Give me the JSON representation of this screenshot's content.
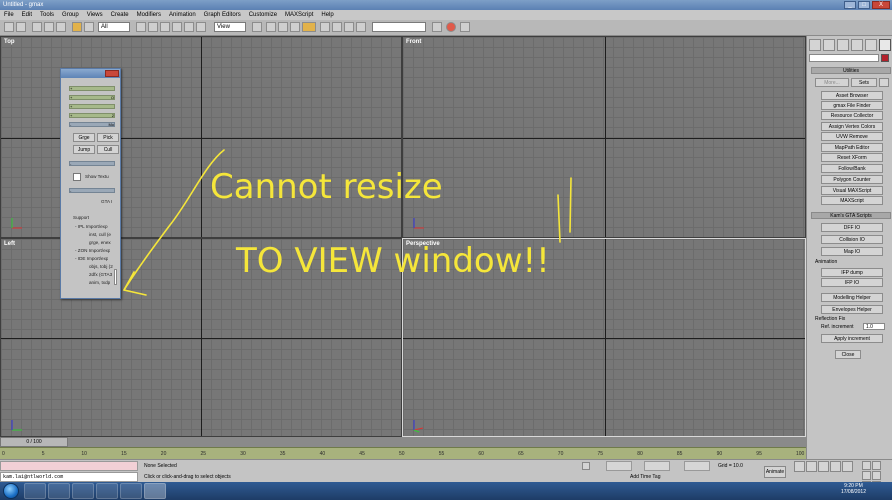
{
  "window": {
    "title": "Untitled - gmax",
    "buttons": [
      "_",
      "□",
      "X"
    ]
  },
  "menu": [
    "File",
    "Edit",
    "Tools",
    "Group",
    "Views",
    "Create",
    "Modifiers",
    "Animation",
    "Graph Editors",
    "Customize",
    "MAXScript",
    "Help"
  ],
  "toolbar": {
    "filter": "All",
    "refcoord": "View",
    "named_selection": ""
  },
  "viewports": {
    "top": "Top",
    "front": "Front",
    "left": "Left",
    "perspective": "Perspective"
  },
  "annotation": {
    "line1": "Cannot resize",
    "line2": "TO VIEW window!!"
  },
  "floater": {
    "rows": [
      "+",
      "+",
      "+",
      "+"
    ],
    "row_suffix": [
      "",
      "O",
      "",
      "2"
    ],
    "section": "Mo",
    "btn_merge": "Grge",
    "btn_pick": "Pick",
    "btn_jump": "Jump",
    "btn_cull": "Cull",
    "checkbox_label": "Show Textu",
    "gta_label": "GTA I",
    "support_title": "Support",
    "support_lines": [
      "- IPL Import/exp",
      "inst, cull (e",
      "grge, enex",
      "- ZON Import/exp",
      "- IDE Import/exp",
      "objs, tobj (2",
      "2dfx (GTA3",
      "anim, txdp"
    ]
  },
  "cmdpanel": {
    "utilities_header": "Utilities",
    "more_label": "More...",
    "sets_label": "Sets",
    "utilities": [
      "Asset Browser",
      "gmax File Finder",
      "Resource Collector",
      "Assign Vertex Colors",
      "UVW Remove",
      "MapPath Editor",
      "Reset XForm",
      "Follow/Bank",
      "Polygon Counter",
      "Visual MAXScript",
      "MAXScript"
    ],
    "kams_header": "Kam's GTA Scripts",
    "kams": [
      "DFF IO",
      "Collision IO",
      "Map IO"
    ],
    "animation_label": "Animation",
    "animation_btns": [
      "IFP dump",
      "IFP IO"
    ],
    "helper_btns": [
      "Modelling Helper",
      "Envelopes Helper"
    ],
    "reflection_label": "Reflection Fix",
    "ref_increment_label": "Ref. increment",
    "ref_increment_value": "1.0",
    "apply_label": "Apply increment",
    "close_label": "Close"
  },
  "timeline": {
    "frame": "0 / 100",
    "ticks": [
      "0",
      "5",
      "10",
      "15",
      "20",
      "25",
      "30",
      "35",
      "40",
      "45",
      "50",
      "55",
      "60",
      "65",
      "70",
      "75",
      "80",
      "85",
      "90",
      "95",
      "100"
    ]
  },
  "status": {
    "maxscript_listener": "",
    "user_email": "kam.lai@ntlworld.com",
    "selection": "None Selected",
    "prompt": "Click or click-and-drag to select objects",
    "grid": "Grid = 10.0",
    "add_time_tag": "Add Time Tag",
    "animate": "Animate"
  },
  "clock": {
    "time": "9:20 PM",
    "date": "17/08/2012"
  },
  "colors": {
    "titlebar": "#5b80b3",
    "viewport": "#777777",
    "annotation": "#f5e63a",
    "trackbar": "#a8b27d",
    "pink_listener": "#f2d0d6"
  }
}
